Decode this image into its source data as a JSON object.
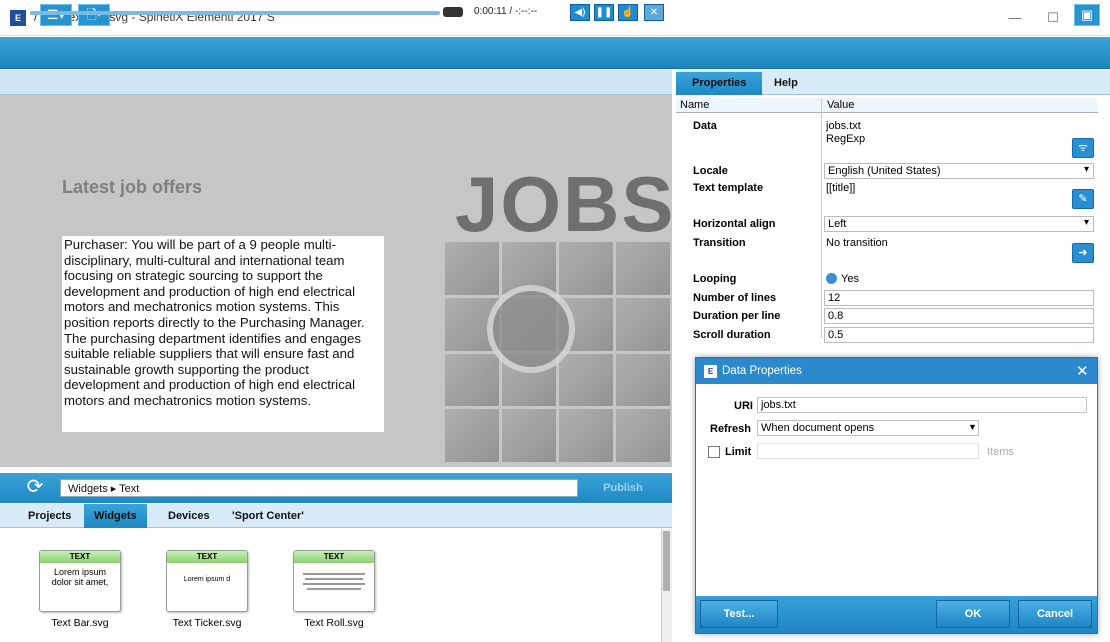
{
  "window": {
    "title": "/Text/Text Bar.svg - SpinetiX Elementi 2017 S",
    "app_icon_text": "E",
    "minimize": "—",
    "maximize": "☐",
    "close": "✕"
  },
  "player": {
    "time": "0:00:11 / -:--:--"
  },
  "canvas": {
    "heading": "Latest job offers",
    "jobs_word": "JOBS",
    "job_text": "Purchaser: You will be part of a 9 people multi-disciplinary, multi-cultural and international team focusing on strategic sourcing to support the development and production of high end electrical motors and mechatronics motion systems. This position reports directly to the Purchasing Manager. The purchasing department identifies and engages suitable reliable suppliers that will ensure fast and sustainable growth supporting the product development and production of high end electrical motors and mechatronics motion systems."
  },
  "breadcrumb": {
    "path": "Widgets ▸ Text",
    "publish_label": "Publish"
  },
  "bottom_tabs": [
    {
      "label": "Projects"
    },
    {
      "label": "Widgets"
    },
    {
      "label": "Devices"
    },
    {
      "label": "'Sport Center'"
    }
  ],
  "widgets": [
    {
      "header": "TEXT",
      "preview": "Lorem ipsum dolor sit amet,",
      "label": "Text Bar.svg"
    },
    {
      "header": "TEXT",
      "preview": "Lorem ipsum d",
      "label": "Text Ticker.svg"
    },
    {
      "header": "TEXT",
      "preview": "",
      "label": "Text Roll.svg"
    }
  ],
  "right_tabs": [
    {
      "label": "Properties"
    },
    {
      "label": "Help"
    }
  ],
  "properties": {
    "col_name": "Name",
    "col_value": "Value",
    "rows": {
      "data": {
        "name": "Data",
        "value1": "jobs.txt",
        "value2": "RegExp"
      },
      "locale": {
        "name": "Locale",
        "value": "English (United States)"
      },
      "text_template": {
        "name": "Text template",
        "value": "[[title]]"
      },
      "halign": {
        "name": "Horizontal align",
        "value": "Left"
      },
      "transition": {
        "name": "Transition",
        "value": "No transition"
      },
      "looping": {
        "name": "Looping",
        "value": "Yes"
      },
      "lines": {
        "name": "Number of lines",
        "value": "12"
      },
      "duration": {
        "name": "Duration per line",
        "value": "0.8"
      },
      "scroll": {
        "name": "Scroll duration",
        "value": "0.5"
      }
    }
  },
  "dialog": {
    "title": "Data Properties",
    "uri_label": "URI",
    "uri_value": "jobs.txt",
    "refresh_label": "Refresh",
    "refresh_value": "When document opens",
    "limit_label": "Limit",
    "items_label": "Items",
    "test_label": "Test...",
    "ok_label": "OK",
    "cancel_label": "Cancel"
  }
}
